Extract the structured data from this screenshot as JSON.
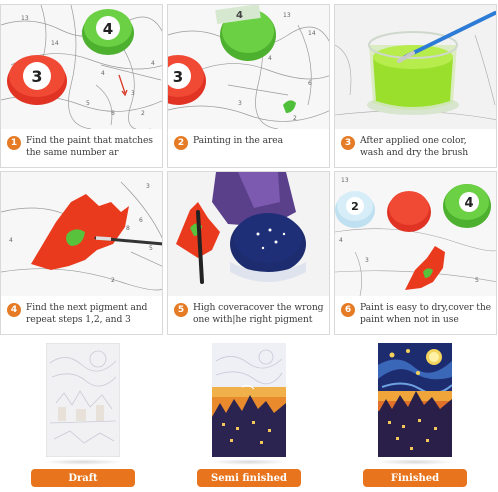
{
  "steps": [
    {
      "number": "1",
      "text": "Find the paint that matches the same number ar"
    },
    {
      "number": "2",
      "text": "Painting in the area"
    },
    {
      "number": "3",
      "text": "After applied one color, wash and dry the brush"
    },
    {
      "number": "4",
      "text": "Find the next pigment and repeat steps 1,2, and 3"
    },
    {
      "number": "5",
      "text": "High coveracover the wrong one with|he right pigment"
    },
    {
      "number": "6",
      "text": "Paint is easy to dry,cover the paint when not in use"
    }
  ],
  "paint_pot_labels": {
    "pot_red": "3",
    "pot_green": "4",
    "pot_blue": "2",
    "pot_green_b": "4"
  },
  "stages": [
    {
      "label": "Draft"
    },
    {
      "label": "Semi finished"
    },
    {
      "label": "Finished"
    }
  ],
  "colors": {
    "accent": "#e8751d",
    "red_paint": "#e8321f",
    "green_paint": "#5cc33a",
    "navy_paint": "#1c2c6e"
  }
}
